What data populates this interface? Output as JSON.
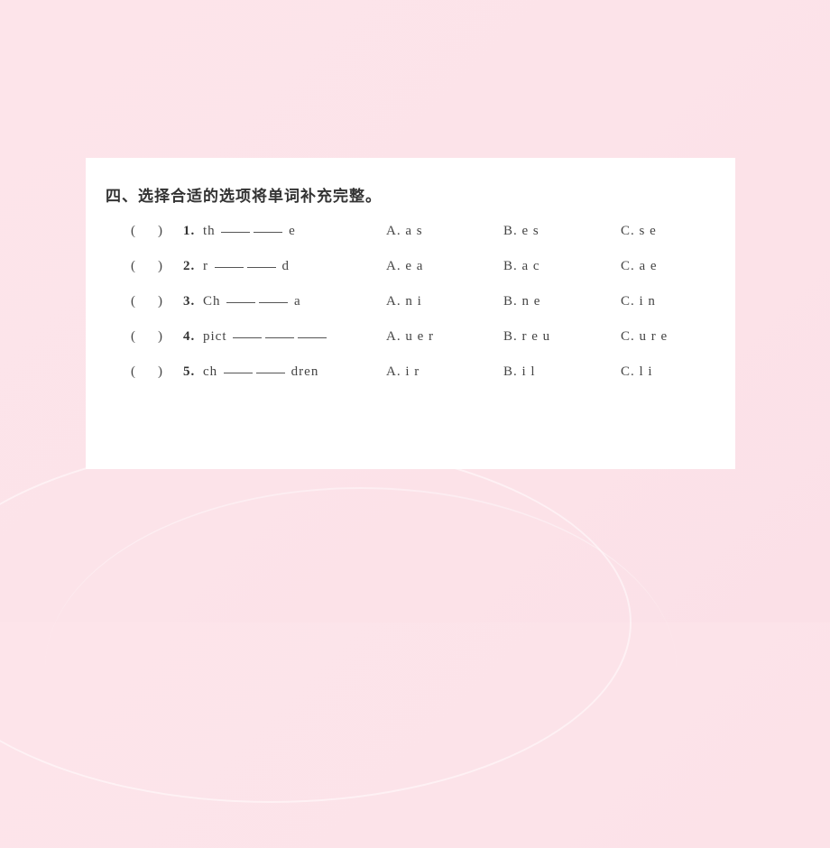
{
  "title": "四、选择合适的选项将单词补充完整。",
  "paren_open": "(",
  "paren_close": ")",
  "questions": [
    {
      "num": "1.",
      "prefix": "th",
      "suffix": "e",
      "blanks": 2,
      "optA": "A. a s",
      "optB": "B. e s",
      "optC": "C. s e"
    },
    {
      "num": "2.",
      "prefix": "r",
      "suffix": "d",
      "blanks": 2,
      "optA": "A. e a",
      "optB": "B. a c",
      "optC": "C. a e"
    },
    {
      "num": "3.",
      "prefix": "Ch",
      "suffix": "a",
      "blanks": 2,
      "optA": "A. n i",
      "optB": "B. n e",
      "optC": "C. i n"
    },
    {
      "num": "4.",
      "prefix": "pict",
      "suffix": "",
      "blanks": 3,
      "optA": "A. u e r",
      "optB": "B. r e u",
      "optC": "C. u r e"
    },
    {
      "num": "5.",
      "prefix": "ch",
      "suffix": "dren",
      "blanks": 2,
      "optA": "A. i r",
      "optB": "B. i l",
      "optC": "C. l i"
    }
  ]
}
